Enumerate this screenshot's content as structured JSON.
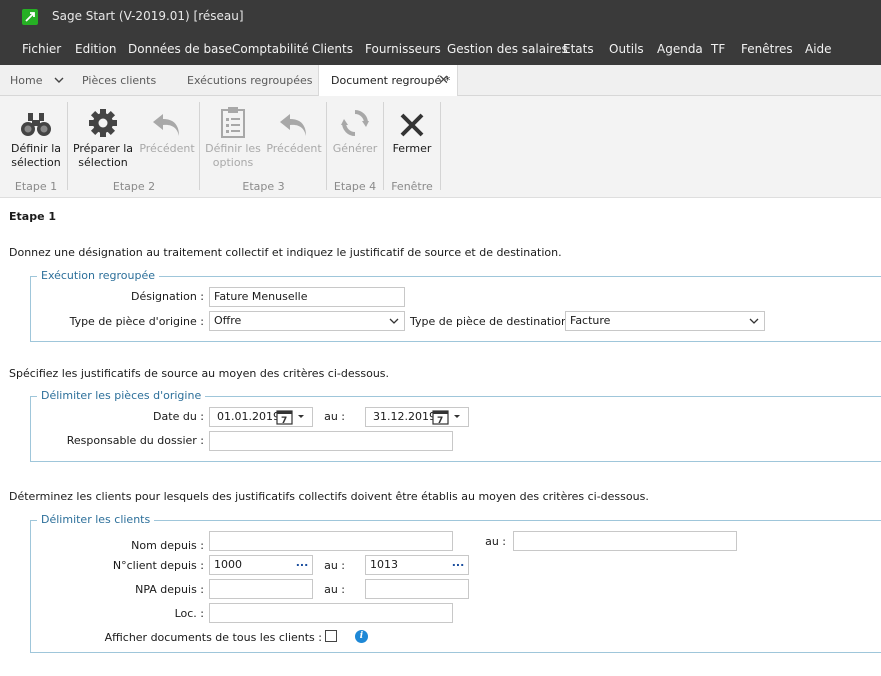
{
  "window": {
    "title": "Sage Start (V-2019.01) [réseau]"
  },
  "menu": [
    "Fichier",
    "Edition",
    "Données de base",
    "Comptabilité",
    "Clients",
    "Fournisseurs",
    "Gestion des salaires",
    "Etats",
    "Outils",
    "Agenda",
    "TF",
    "Fenêtres",
    "Aide"
  ],
  "tabs": {
    "home": "Home",
    "t1": "Pièces clients",
    "t2": "Exécutions regroupées",
    "t3": "Document regroupé *"
  },
  "ribbon": {
    "b1": [
      "Définir la",
      "sélection"
    ],
    "b2": [
      "Préparer la",
      "sélection"
    ],
    "b3": [
      "Précédent"
    ],
    "b4": [
      "Définir les",
      "options"
    ],
    "b5": [
      "Précédent"
    ],
    "b6": [
      "Générer"
    ],
    "b7": [
      "Fermer"
    ],
    "groups": [
      "Etape 1",
      "Etape 2",
      "Etape 3",
      "Etape 4",
      "Fenêtre"
    ]
  },
  "page": {
    "heading": "Etape 1",
    "intro1": "Donnez une désignation au traitement collectif et indiquez le justificatif de source et de destination.",
    "intro2": "Spécifiez les justificatifs de source au moyen des critères ci-dessous.",
    "intro3": "Déterminez les clients pour lesquels des justificatifs collectifs doivent être établis au moyen des critères ci-dessous."
  },
  "exec": {
    "legend": "Exécution regroupée",
    "designation_label": "Désignation :",
    "designation_value": "Fature Menuselle",
    "origin_label": "Type de pièce d'origine :",
    "origin_value": "Offre",
    "dest_label": "Type de pièce de destination :",
    "dest_value": "Facture"
  },
  "pieces": {
    "legend": "Délimiter les pièces d'origine",
    "date_from_label": "Date du :",
    "date_from": "01.01.2019",
    "to_label": "au :",
    "date_to": "31.12.2019",
    "resp_label": "Responsable du dossier :",
    "resp_value": "",
    "cal_day": "7"
  },
  "clients": {
    "legend": "Délimiter les clients",
    "nom_label": "Nom depuis :",
    "nom_from": "",
    "nom_to_label": "au :",
    "nom_to": "",
    "num_label": "N°client depuis :",
    "num_from": "1000",
    "num_to_label": "au :",
    "num_to": "1013",
    "npa_label": "NPA depuis :",
    "npa_from": "",
    "npa_to_label": "au :",
    "npa_to": "",
    "loc_label": "Loc. :",
    "loc_value": "",
    "show_all_label": "Afficher documents de tous les clients :",
    "dots": "...",
    "info_glyph": "i"
  },
  "icons": {
    "logo": "sage-logo-icon",
    "close": "✕",
    "chevron": "⌄",
    "arrow": "⌄"
  },
  "colors": {
    "titlebar": "#3a3a3a",
    "legend": "#2c6f9a",
    "group_border": "#9fc6da",
    "info": "#1e88d6"
  }
}
